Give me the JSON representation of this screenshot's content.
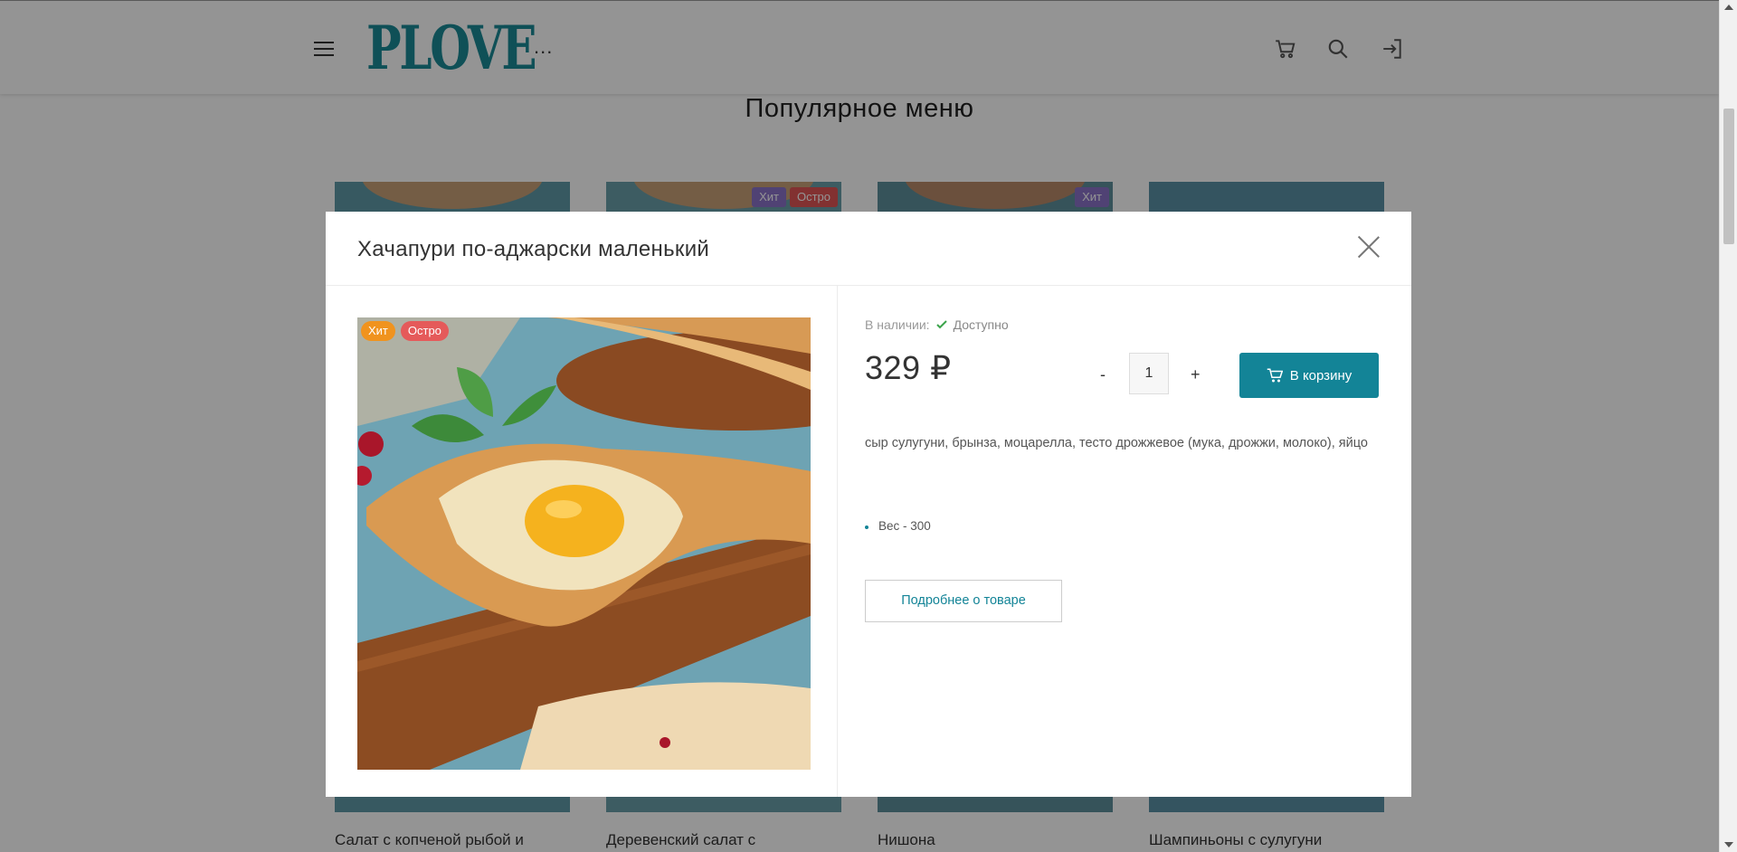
{
  "header": {
    "logo_text": "PLOVE",
    "more_label": "...",
    "icons": [
      "menu-icon",
      "cart-icon",
      "search-icon",
      "login-icon"
    ]
  },
  "section": {
    "title": "Популярное меню"
  },
  "cards": [
    {
      "name": "Салат с копченой рыбой и",
      "badges": []
    },
    {
      "name": "Деревенский салат с",
      "badges": [
        "Хит",
        "Остро"
      ]
    },
    {
      "name": "Нишона",
      "badges": [
        "Хит"
      ]
    },
    {
      "name": "Шампиньоны с сулугуни",
      "badges": []
    }
  ],
  "modal": {
    "title": "Хачапури по-аджарски маленький",
    "badges": {
      "hit": "Хит",
      "hot": "Остро"
    },
    "availability_label": "В наличии:",
    "availability_value": "Доступно",
    "price": "329 ₽",
    "quantity": "1",
    "minus": "-",
    "plus": "+",
    "cart_button": "В корзину",
    "description": "сыр сулугуни, брынза, моцарелла, тесто дрожжевое (мука, дрожжи, молоко), яйцо",
    "properties": [
      "Вес - 300"
    ],
    "more_button": "Подробнее о товаре"
  },
  "colors": {
    "accent": "#138497",
    "logo": "#1a8a96",
    "badge_hit": "#f0931e",
    "badge_hot": "#e55a5a"
  }
}
